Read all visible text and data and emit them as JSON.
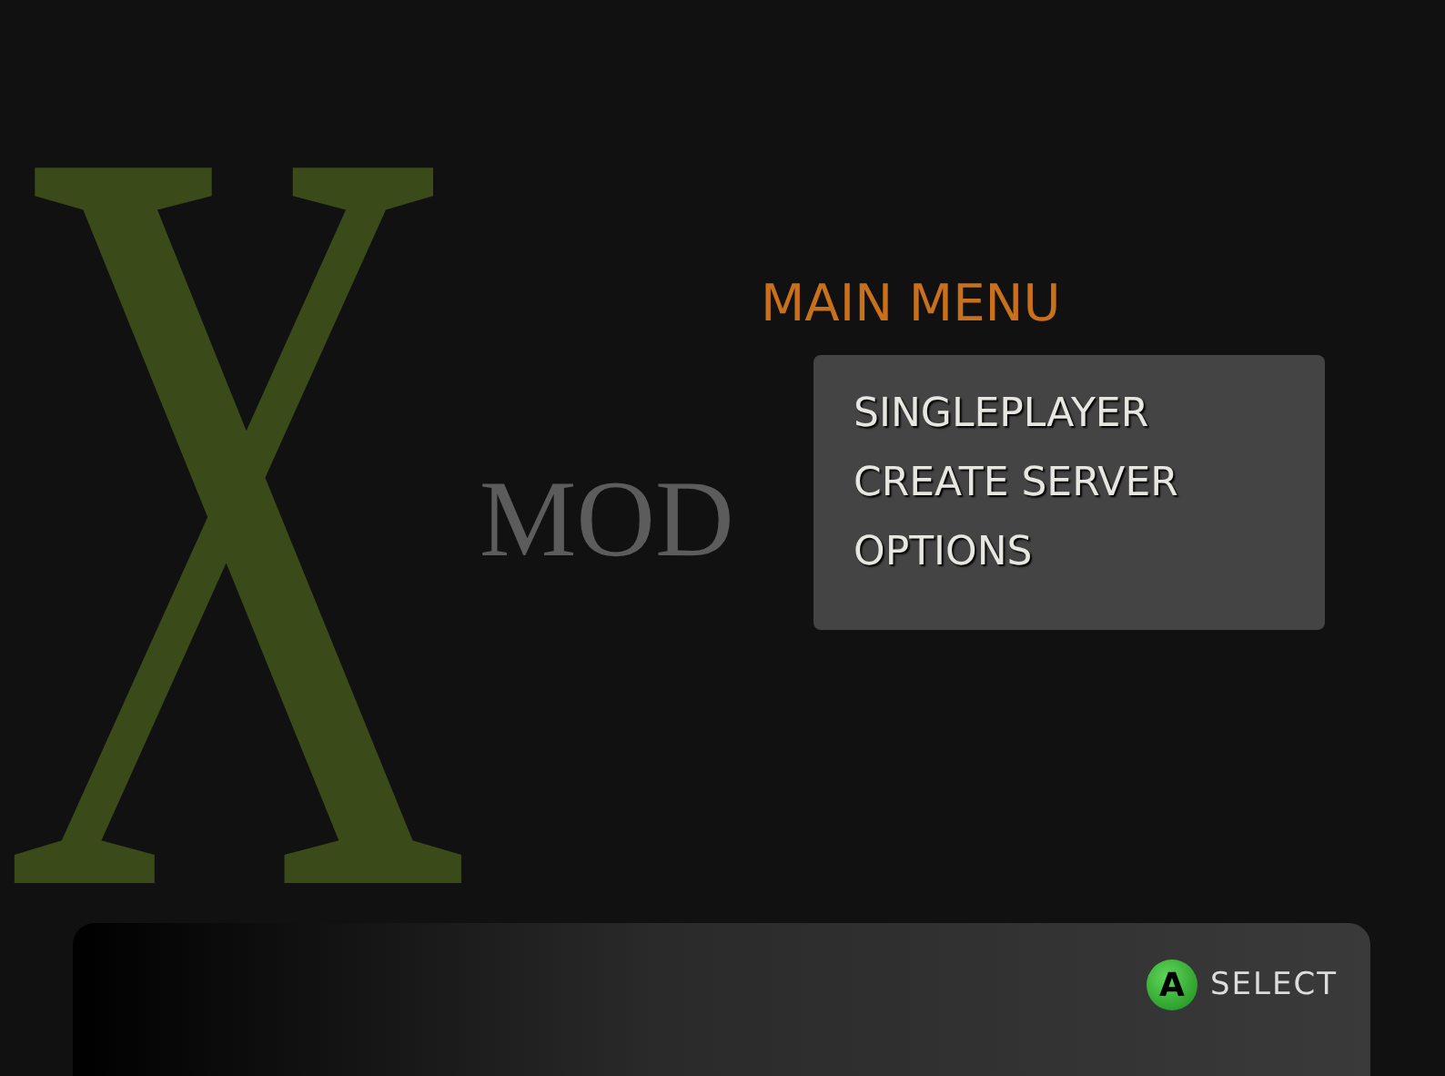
{
  "logo": {
    "letter": "X",
    "word": "MOD"
  },
  "menu": {
    "title": "MAIN MENU",
    "items": [
      {
        "label": "SINGLEPLAYER"
      },
      {
        "label": "CREATE SERVER"
      },
      {
        "label": "OPTIONS"
      }
    ]
  },
  "footer": {
    "hints": [
      {
        "key": "A",
        "label": "SELECT"
      }
    ]
  }
}
